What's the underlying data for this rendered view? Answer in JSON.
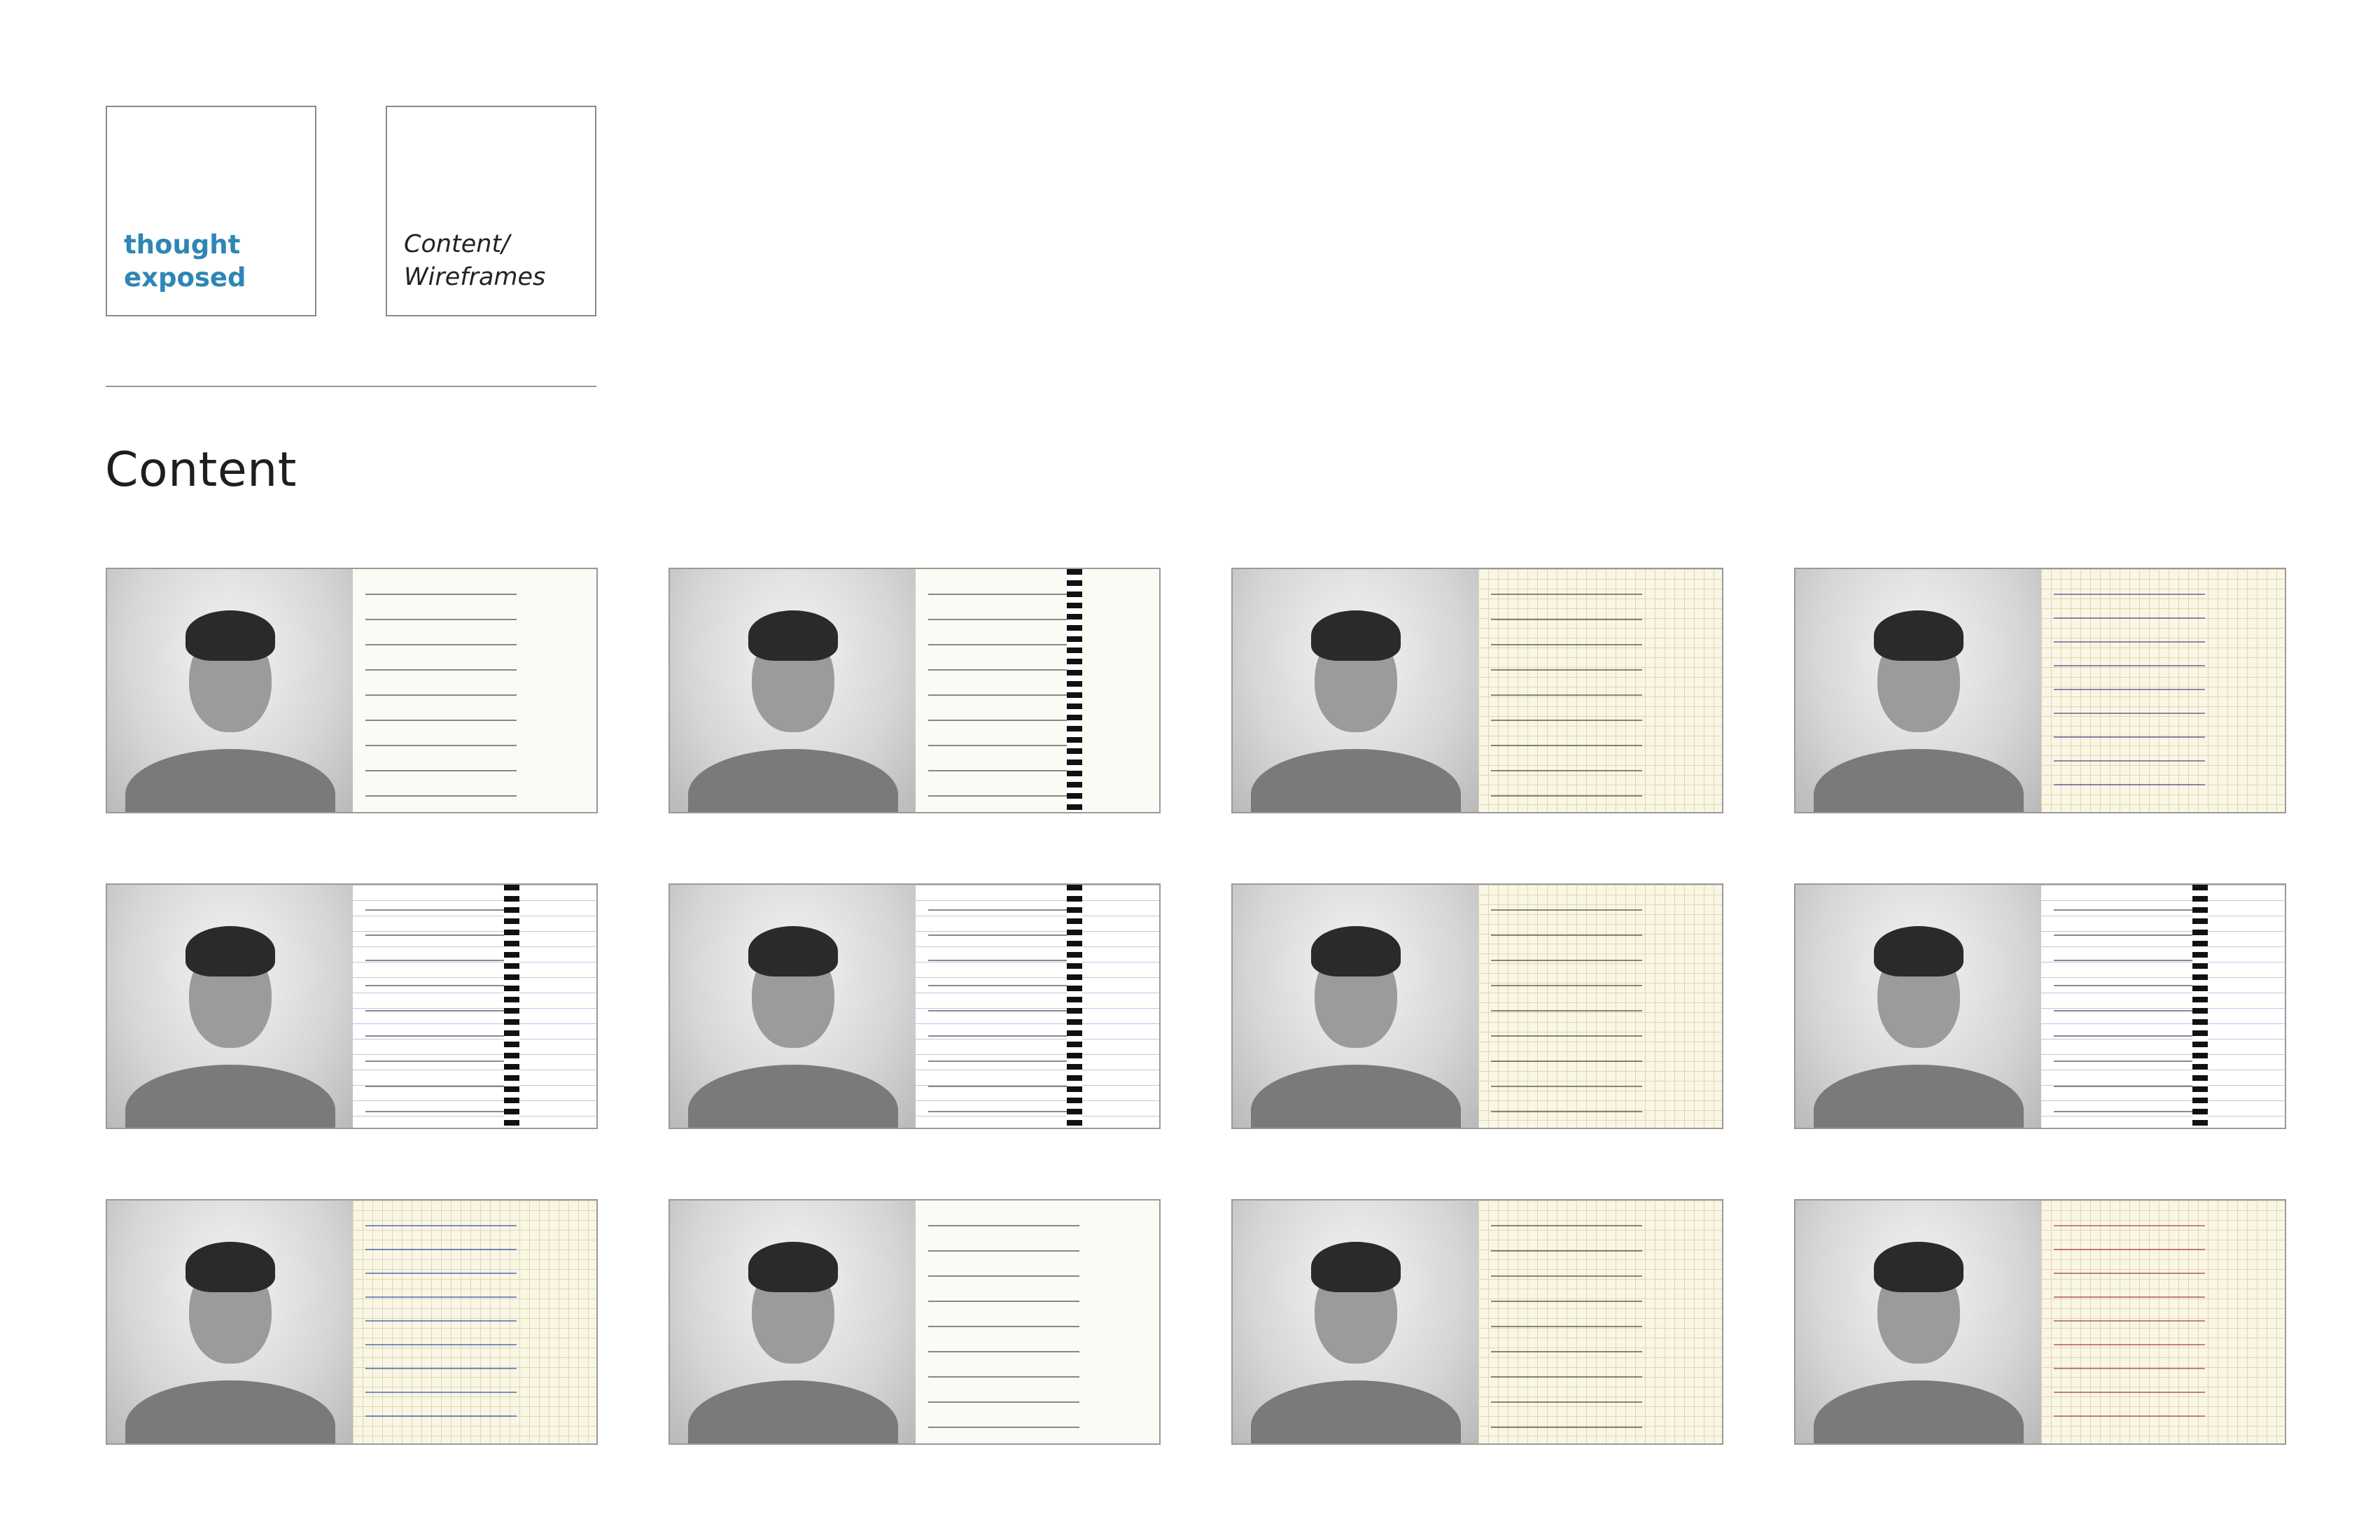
{
  "brand": {
    "line1": "thought",
    "line2": "exposed"
  },
  "nav": {
    "line1": "Content/",
    "line2": "Wireframes"
  },
  "section": {
    "title": "Content"
  },
  "cards": [
    {
      "label": "portrait-1",
      "notebook_style": "plain",
      "ink": "dark"
    },
    {
      "label": "portrait-2",
      "notebook_style": "plain",
      "ink": "dark"
    },
    {
      "label": "portrait-3",
      "notebook_style": "grid",
      "ink": "dark"
    },
    {
      "label": "portrait-4",
      "notebook_style": "grid",
      "ink": "purple"
    },
    {
      "label": "portrait-5",
      "notebook_style": "ruled",
      "ink": "dark"
    },
    {
      "label": "portrait-6",
      "notebook_style": "ruled",
      "ink": "dark"
    },
    {
      "label": "portrait-7",
      "notebook_style": "grid",
      "ink": "dark"
    },
    {
      "label": "portrait-8",
      "notebook_style": "ruled",
      "ink": "dark"
    },
    {
      "label": "portrait-9",
      "notebook_style": "grid",
      "ink": "blue"
    },
    {
      "label": "portrait-10",
      "notebook_style": "plain",
      "ink": "dark"
    },
    {
      "label": "portrait-11",
      "notebook_style": "grid",
      "ink": "dark"
    },
    {
      "label": "portrait-12",
      "notebook_style": "grid",
      "ink": "red"
    }
  ],
  "colors": {
    "brand": "#2e86b4",
    "border": "#8a8a8a",
    "divider": "#9a9a9a"
  }
}
